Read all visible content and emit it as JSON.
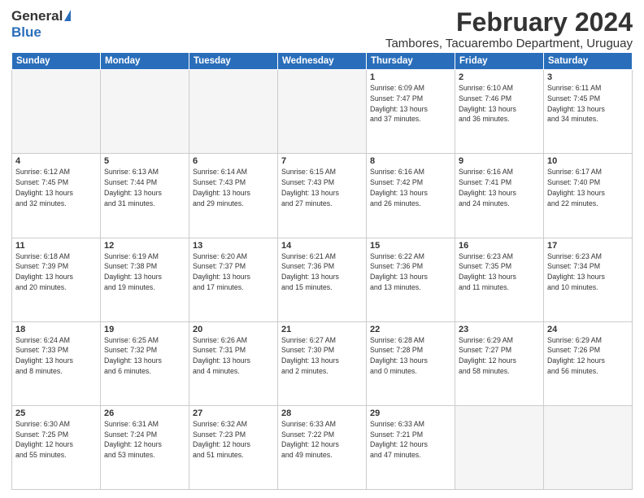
{
  "logo": {
    "general": "General",
    "blue": "Blue"
  },
  "title": "February 2024",
  "subtitle": "Tambores, Tacuarembo Department, Uruguay",
  "days_of_week": [
    "Sunday",
    "Monday",
    "Tuesday",
    "Wednesday",
    "Thursday",
    "Friday",
    "Saturday"
  ],
  "weeks": [
    [
      {
        "day": "",
        "info": ""
      },
      {
        "day": "",
        "info": ""
      },
      {
        "day": "",
        "info": ""
      },
      {
        "day": "",
        "info": ""
      },
      {
        "day": "1",
        "info": "Sunrise: 6:09 AM\nSunset: 7:47 PM\nDaylight: 13 hours\nand 37 minutes."
      },
      {
        "day": "2",
        "info": "Sunrise: 6:10 AM\nSunset: 7:46 PM\nDaylight: 13 hours\nand 36 minutes."
      },
      {
        "day": "3",
        "info": "Sunrise: 6:11 AM\nSunset: 7:45 PM\nDaylight: 13 hours\nand 34 minutes."
      }
    ],
    [
      {
        "day": "4",
        "info": "Sunrise: 6:12 AM\nSunset: 7:45 PM\nDaylight: 13 hours\nand 32 minutes."
      },
      {
        "day": "5",
        "info": "Sunrise: 6:13 AM\nSunset: 7:44 PM\nDaylight: 13 hours\nand 31 minutes."
      },
      {
        "day": "6",
        "info": "Sunrise: 6:14 AM\nSunset: 7:43 PM\nDaylight: 13 hours\nand 29 minutes."
      },
      {
        "day": "7",
        "info": "Sunrise: 6:15 AM\nSunset: 7:43 PM\nDaylight: 13 hours\nand 27 minutes."
      },
      {
        "day": "8",
        "info": "Sunrise: 6:16 AM\nSunset: 7:42 PM\nDaylight: 13 hours\nand 26 minutes."
      },
      {
        "day": "9",
        "info": "Sunrise: 6:16 AM\nSunset: 7:41 PM\nDaylight: 13 hours\nand 24 minutes."
      },
      {
        "day": "10",
        "info": "Sunrise: 6:17 AM\nSunset: 7:40 PM\nDaylight: 13 hours\nand 22 minutes."
      }
    ],
    [
      {
        "day": "11",
        "info": "Sunrise: 6:18 AM\nSunset: 7:39 PM\nDaylight: 13 hours\nand 20 minutes."
      },
      {
        "day": "12",
        "info": "Sunrise: 6:19 AM\nSunset: 7:38 PM\nDaylight: 13 hours\nand 19 minutes."
      },
      {
        "day": "13",
        "info": "Sunrise: 6:20 AM\nSunset: 7:37 PM\nDaylight: 13 hours\nand 17 minutes."
      },
      {
        "day": "14",
        "info": "Sunrise: 6:21 AM\nSunset: 7:36 PM\nDaylight: 13 hours\nand 15 minutes."
      },
      {
        "day": "15",
        "info": "Sunrise: 6:22 AM\nSunset: 7:36 PM\nDaylight: 13 hours\nand 13 minutes."
      },
      {
        "day": "16",
        "info": "Sunrise: 6:23 AM\nSunset: 7:35 PM\nDaylight: 13 hours\nand 11 minutes."
      },
      {
        "day": "17",
        "info": "Sunrise: 6:23 AM\nSunset: 7:34 PM\nDaylight: 13 hours\nand 10 minutes."
      }
    ],
    [
      {
        "day": "18",
        "info": "Sunrise: 6:24 AM\nSunset: 7:33 PM\nDaylight: 13 hours\nand 8 minutes."
      },
      {
        "day": "19",
        "info": "Sunrise: 6:25 AM\nSunset: 7:32 PM\nDaylight: 13 hours\nand 6 minutes."
      },
      {
        "day": "20",
        "info": "Sunrise: 6:26 AM\nSunset: 7:31 PM\nDaylight: 13 hours\nand 4 minutes."
      },
      {
        "day": "21",
        "info": "Sunrise: 6:27 AM\nSunset: 7:30 PM\nDaylight: 13 hours\nand 2 minutes."
      },
      {
        "day": "22",
        "info": "Sunrise: 6:28 AM\nSunset: 7:28 PM\nDaylight: 13 hours\nand 0 minutes."
      },
      {
        "day": "23",
        "info": "Sunrise: 6:29 AM\nSunset: 7:27 PM\nDaylight: 12 hours\nand 58 minutes."
      },
      {
        "day": "24",
        "info": "Sunrise: 6:29 AM\nSunset: 7:26 PM\nDaylight: 12 hours\nand 56 minutes."
      }
    ],
    [
      {
        "day": "25",
        "info": "Sunrise: 6:30 AM\nSunset: 7:25 PM\nDaylight: 12 hours\nand 55 minutes."
      },
      {
        "day": "26",
        "info": "Sunrise: 6:31 AM\nSunset: 7:24 PM\nDaylight: 12 hours\nand 53 minutes."
      },
      {
        "day": "27",
        "info": "Sunrise: 6:32 AM\nSunset: 7:23 PM\nDaylight: 12 hours\nand 51 minutes."
      },
      {
        "day": "28",
        "info": "Sunrise: 6:33 AM\nSunset: 7:22 PM\nDaylight: 12 hours\nand 49 minutes."
      },
      {
        "day": "29",
        "info": "Sunrise: 6:33 AM\nSunset: 7:21 PM\nDaylight: 12 hours\nand 47 minutes."
      },
      {
        "day": "",
        "info": ""
      },
      {
        "day": "",
        "info": ""
      }
    ]
  ]
}
